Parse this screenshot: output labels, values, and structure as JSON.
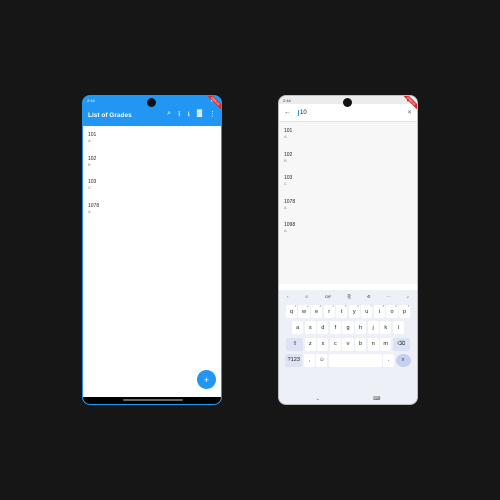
{
  "left_screen": {
    "status": {
      "time": "2:44",
      "icons": "⚙ ✖",
      "right": "▼◢"
    },
    "debug_banner": "DEBUG",
    "app_title": "List of Grades",
    "actions": {
      "search": "⌕",
      "upload": "⭱",
      "download": "⭳",
      "chart": "▓",
      "menu": "⋮"
    },
    "grades": [
      {
        "id": "101",
        "grade": "A"
      },
      {
        "id": "102",
        "grade": "B"
      },
      {
        "id": "103",
        "grade": "C"
      },
      {
        "id": "1078",
        "grade": "A"
      }
    ],
    "fab_label": "+"
  },
  "right_screen": {
    "status": {
      "time": "2:44",
      "right": "▼◢"
    },
    "debug_banner": "DEBUG",
    "search": {
      "back": "←",
      "query": "10",
      "clear": "✕"
    },
    "results": [
      {
        "id": "101",
        "grade": "A"
      },
      {
        "id": "102",
        "grade": "B"
      },
      {
        "id": "103",
        "grade": "C"
      },
      {
        "id": "1078",
        "grade": "A"
      },
      {
        "id": "1098",
        "grade": "A"
      }
    ],
    "keyboard": {
      "toolbar": [
        "‹",
        "☺",
        "GIF",
        "⎘",
        "⚙",
        "···",
        "♪"
      ],
      "row1": [
        {
          "k": "q",
          "n": "1"
        },
        {
          "k": "w",
          "n": "2"
        },
        {
          "k": "e",
          "n": "3"
        },
        {
          "k": "r",
          "n": "4"
        },
        {
          "k": "t",
          "n": "5"
        },
        {
          "k": "y",
          "n": "6"
        },
        {
          "k": "u",
          "n": "7"
        },
        {
          "k": "i",
          "n": "8"
        },
        {
          "k": "o",
          "n": "9"
        },
        {
          "k": "p",
          "n": "0"
        }
      ],
      "row2": [
        "a",
        "s",
        "d",
        "f",
        "g",
        "h",
        "j",
        "k",
        "l"
      ],
      "row3": [
        "⇧",
        "z",
        "x",
        "c",
        "v",
        "b",
        "n",
        "m",
        "⌫"
      ],
      "row4": [
        "?123",
        ",",
        "☺",
        "",
        ".",
        "⌕"
      ],
      "nav": [
        "⌄",
        "⌨"
      ]
    }
  }
}
